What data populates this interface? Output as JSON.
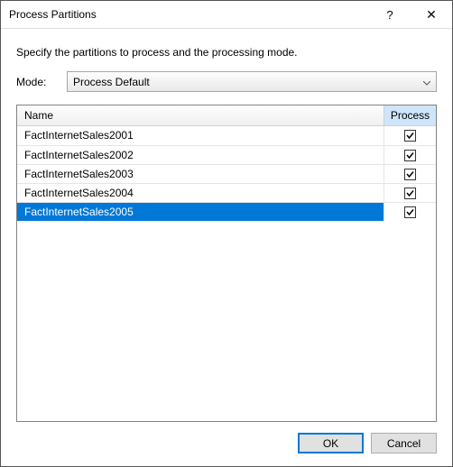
{
  "window": {
    "title": "Process Partitions"
  },
  "instruction": "Specify the partitions to process and the processing mode.",
  "mode": {
    "label": "Mode:",
    "value": "Process Default"
  },
  "grid": {
    "columns": {
      "name": "Name",
      "process": "Process"
    },
    "rows": [
      {
        "name": "FactInternetSales2001",
        "checked": true,
        "selected": false
      },
      {
        "name": "FactInternetSales2002",
        "checked": true,
        "selected": false
      },
      {
        "name": "FactInternetSales2003",
        "checked": true,
        "selected": false
      },
      {
        "name": "FactInternetSales2004",
        "checked": true,
        "selected": false
      },
      {
        "name": "FactInternetSales2005",
        "checked": true,
        "selected": true
      }
    ]
  },
  "buttons": {
    "ok": "OK",
    "cancel": "Cancel"
  },
  "icons": {
    "help": "?",
    "close": "✕"
  }
}
